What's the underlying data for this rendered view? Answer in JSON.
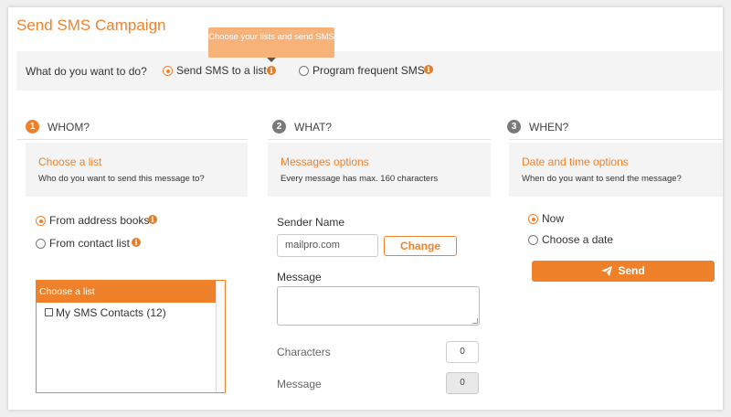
{
  "page": {
    "title": "Send SMS Campaign"
  },
  "tooltip": {
    "text": "Choose your lists and send SMS"
  },
  "question": {
    "label": "What do you want to do?",
    "options": [
      {
        "label": "Send SMS to a list",
        "selected": true
      },
      {
        "label": "Program frequent SMS",
        "selected": false
      }
    ]
  },
  "steps": [
    {
      "number": "1",
      "title": "WHOM?",
      "info_title": "Choose a list",
      "info_desc": "Who do you want to send this message to?"
    },
    {
      "number": "2",
      "title": "WHAT?",
      "info_title": "Messages options",
      "info_desc": "Every message has max. 160 characters"
    },
    {
      "number": "3",
      "title": "WHEN?",
      "info_title": "Date and time options",
      "info_desc": "When do you want to send the message?"
    }
  ],
  "whom": {
    "sources": [
      {
        "label": "From address books",
        "selected": true
      },
      {
        "label": "From contact list",
        "selected": false
      }
    ],
    "list_header": "Choose a list",
    "lists": [
      {
        "label": "My SMS Contacts (12)",
        "checked": false
      }
    ]
  },
  "what": {
    "sender_label": "Sender Name",
    "sender_value": "mailpro.com",
    "change_button": "Change",
    "message_label": "Message",
    "message_value": "",
    "characters_label": "Characters",
    "characters_value": "0",
    "messages_label": "Message",
    "messages_value": "0"
  },
  "when": {
    "options": [
      {
        "label": "Now",
        "selected": true
      },
      {
        "label": "Choose a date",
        "selected": false
      }
    ],
    "send_button": "Send"
  },
  "colors": {
    "accent": "#f0812b",
    "panel": "#f4f4f4",
    "step_inactive": "#7a7a7a"
  },
  "icons": [
    "info-icon",
    "paper-plane-icon",
    "radio-icon",
    "checkbox-icon"
  ]
}
